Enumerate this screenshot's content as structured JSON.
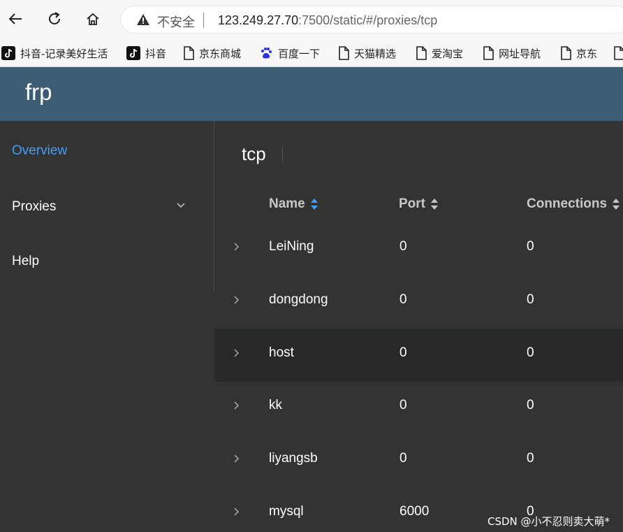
{
  "browser": {
    "security_text": "不安全",
    "url_host": "123.249.27.70",
    "url_rest": ":7500/static/#/proxies/tcp",
    "bookmarks": [
      {
        "label": "抖音-记录美好生活",
        "icon": "tiktok-icon"
      },
      {
        "label": "抖音",
        "icon": "tiktok-icon"
      },
      {
        "label": "京东商城",
        "icon": "page-icon"
      },
      {
        "label": "百度一下",
        "icon": "baidu-icon"
      },
      {
        "label": "天猫精选",
        "icon": "page-icon"
      },
      {
        "label": "爱淘宝",
        "icon": "page-icon"
      },
      {
        "label": "网址导航",
        "icon": "page-icon"
      },
      {
        "label": "京东",
        "icon": "page-icon"
      }
    ]
  },
  "app": {
    "title": "frp"
  },
  "sidebar": {
    "items": [
      {
        "label": "Overview",
        "active": true
      },
      {
        "label": "Proxies",
        "active": false
      },
      {
        "label": "Help",
        "active": false
      }
    ]
  },
  "main": {
    "tab": "tcp",
    "columns": [
      "Name",
      "Port",
      "Connections"
    ],
    "rows": [
      {
        "name": "LeiNing",
        "port": "0",
        "connections": "0"
      },
      {
        "name": "dongdong",
        "port": "0",
        "connections": "0"
      },
      {
        "name": "host",
        "port": "0",
        "connections": "0"
      },
      {
        "name": "kk",
        "port": "0",
        "connections": "0"
      },
      {
        "name": "liyangsb",
        "port": "0",
        "connections": "0"
      },
      {
        "name": "mysql",
        "port": "6000",
        "connections": "0"
      }
    ]
  },
  "watermark": "CSDN @小不忍则卖大萌*",
  "colors": {
    "header": "#3d5d74",
    "background": "#333331",
    "active_link": "#409eff",
    "hover_row": "#272927"
  }
}
